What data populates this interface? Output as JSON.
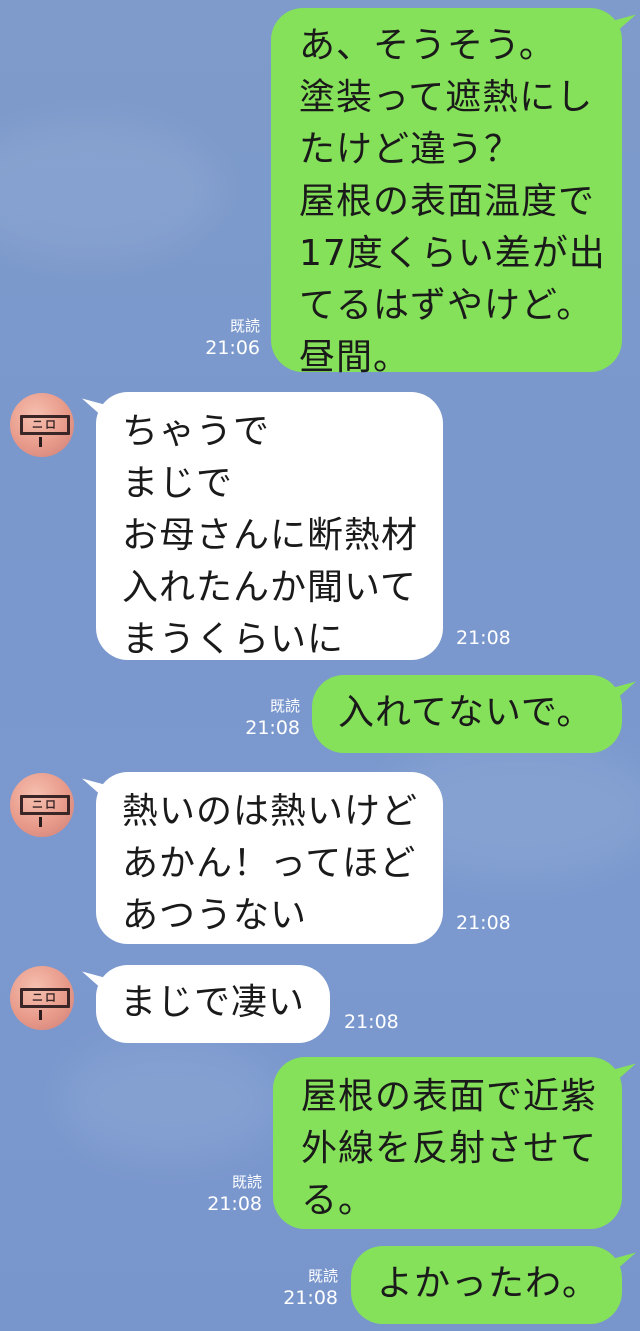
{
  "messages": [
    {
      "side": "out",
      "text": "あ、そうそう。\n塗装って遮熱にし\nたけど違う？\n屋根の表面温度で\n17度くらい差が出\nてるはずやけど。\n昼間。",
      "read": "既読",
      "time": "21:06"
    },
    {
      "side": "in",
      "text": "ちゃうで\nまじで\nお母さんに断熱材\n入れたんか聞いて\nまうくらいに",
      "time": "21:08"
    },
    {
      "side": "out",
      "text": "入れてないで。",
      "read": "既読",
      "time": "21:08"
    },
    {
      "side": "in",
      "text": "熱いのは熱いけど\nあかん！ってほど\nあつうない",
      "time": "21:08"
    },
    {
      "side": "in",
      "text": "まじで凄い",
      "time": "21:08"
    },
    {
      "side": "out",
      "text": "屋根の表面で近紫\n外線を反射させて\nる。",
      "read": "既読",
      "time": "21:08"
    },
    {
      "side": "out",
      "text": "よかったわ。",
      "read": "既読",
      "time": "21:08"
    }
  ],
  "avatar": {
    "label": "ニロ",
    "icon": "profile-avatar"
  },
  "colors": {
    "outgoing_bubble": "#85e05a",
    "incoming_bubble": "#ffffff",
    "background": "#7b99cc"
  }
}
